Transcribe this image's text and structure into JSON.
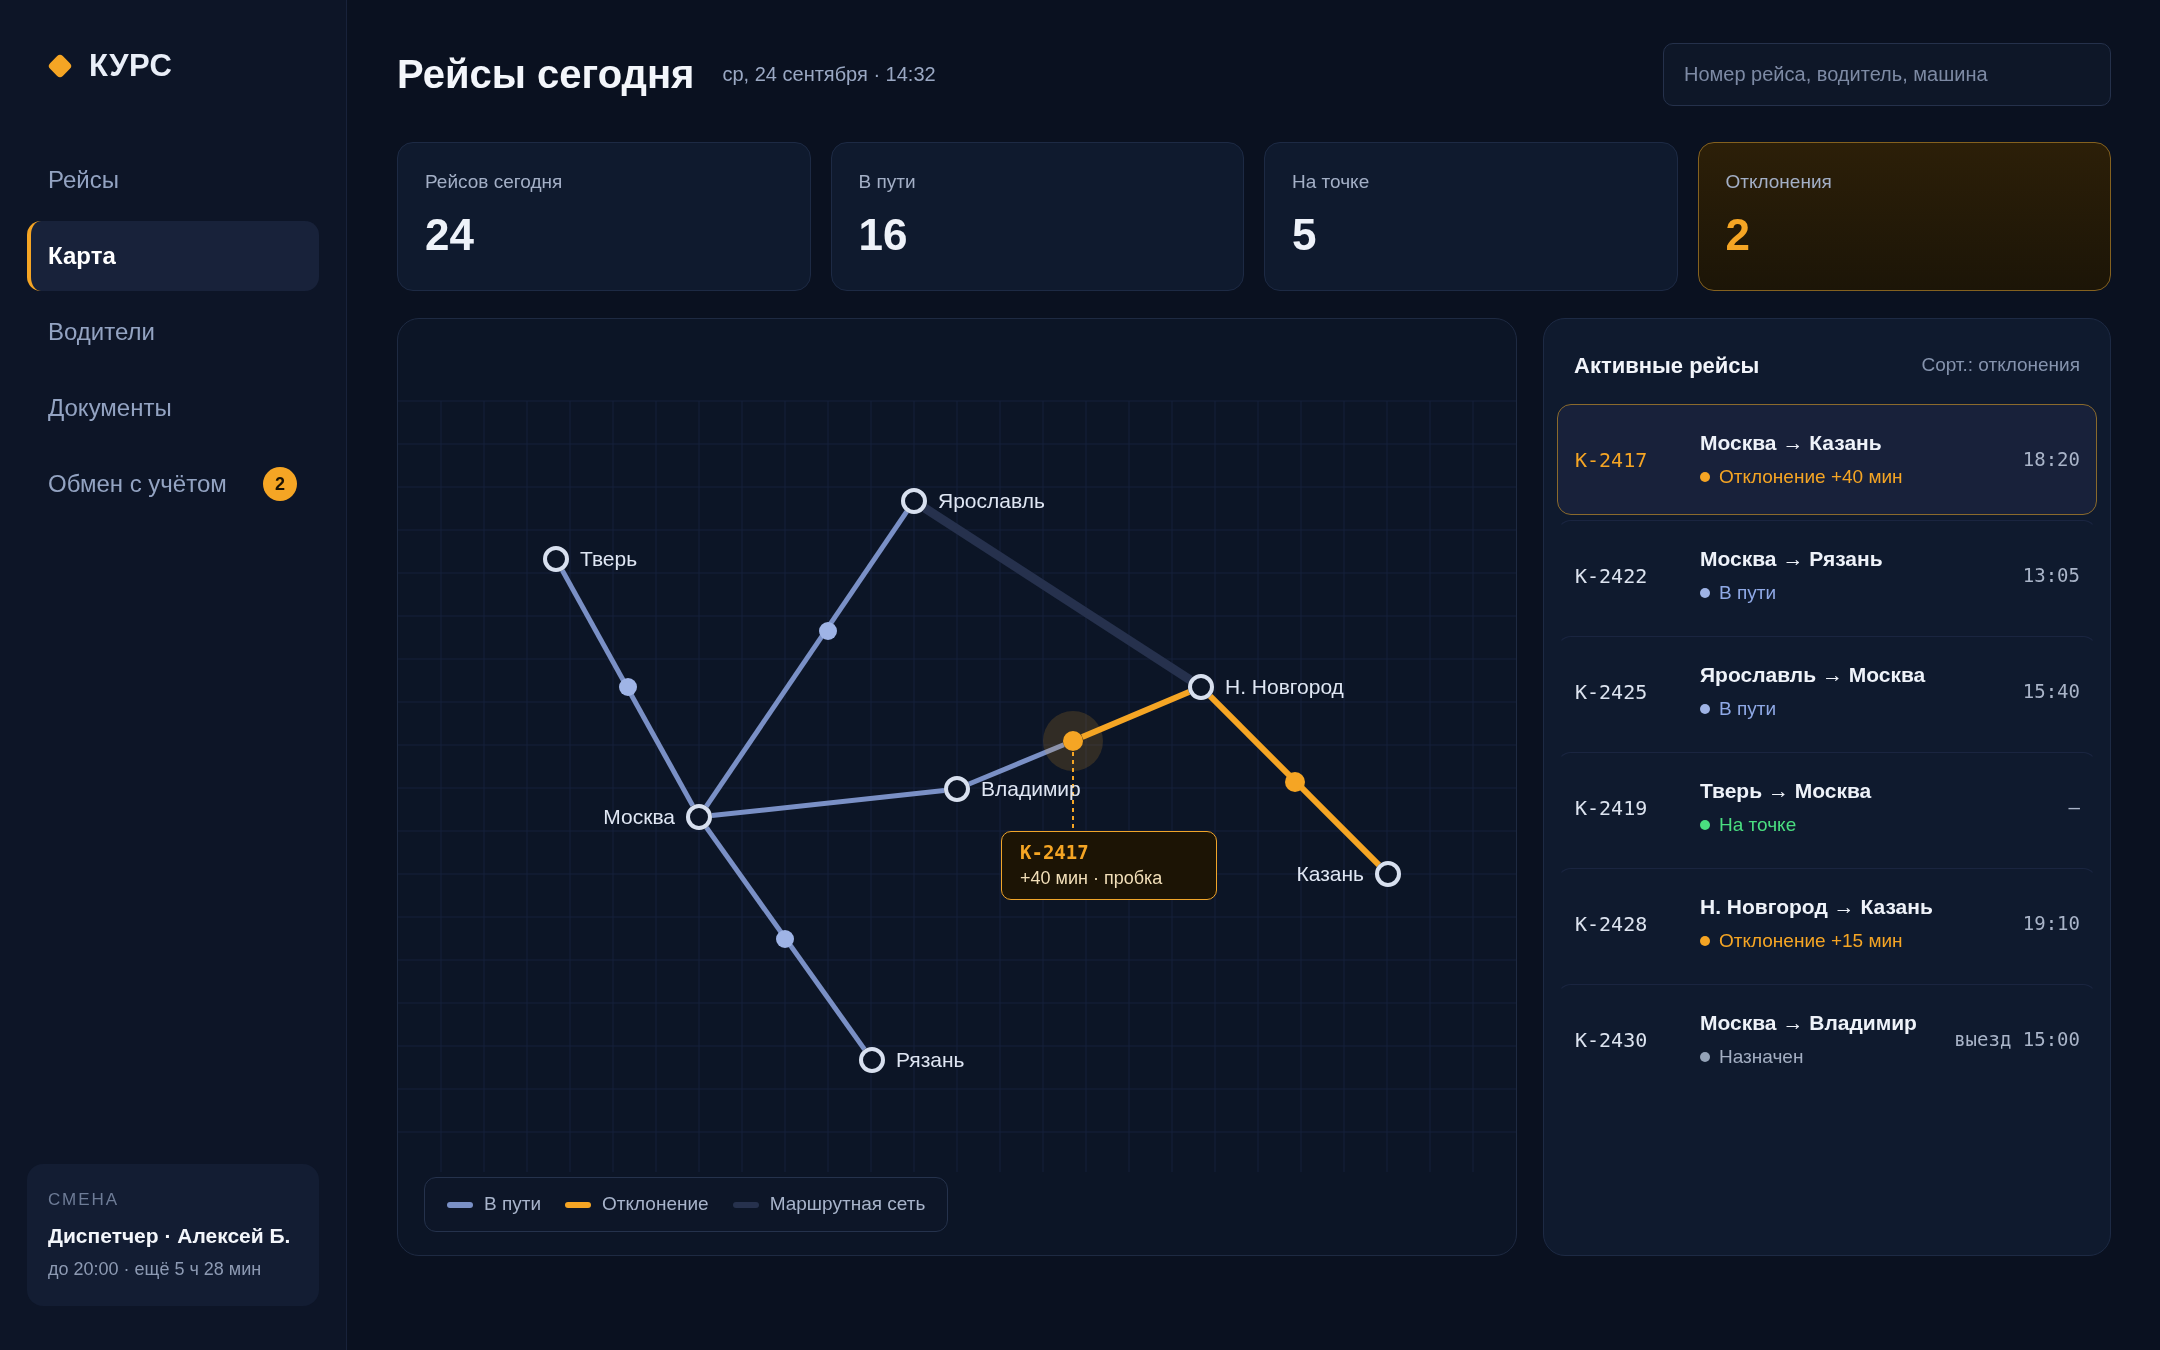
{
  "brand": {
    "name": "КУРС"
  },
  "sidebar": {
    "items": [
      {
        "label": "Рейсы",
        "selected": false
      },
      {
        "label": "Карта",
        "selected": true
      },
      {
        "label": "Водители",
        "selected": false
      },
      {
        "label": "Документы",
        "selected": false
      },
      {
        "label": "Обмен с учётом",
        "selected": false,
        "badge": "2"
      }
    ],
    "shift": {
      "label": "СМЕНА",
      "title": "Диспетчер · Алексей Б.",
      "subtitle": "до 20:00 · ещё 5 ч 28 мин"
    }
  },
  "header": {
    "title": "Рейсы сегодня",
    "date": "ср, 24 сентября · 14:32",
    "search": {
      "placeholder": "Номер рейса, водитель, машина"
    }
  },
  "stats": [
    {
      "label": "Рейсов сегодня",
      "value": "24",
      "kind": "normal"
    },
    {
      "label": "В пути",
      "value": "16",
      "kind": "normal"
    },
    {
      "label": "На точке",
      "value": "5",
      "kind": "normal"
    },
    {
      "label": "Отклонения",
      "value": "2",
      "kind": "alert"
    }
  ],
  "map": {
    "segments": [
      {
        "kind": "in_transit"
      },
      {
        "kind": "in_transit"
      },
      {
        "kind": "in_transit"
      },
      {
        "kind": "in_transit"
      },
      {
        "kind": "in_transit"
      },
      {
        "kind": "deviation"
      },
      {
        "kind": "deviation"
      },
      {
        "kind": "network"
      }
    ],
    "cities": [
      {
        "name": "Тверь"
      },
      {
        "name": "Ярославль"
      },
      {
        "name": "Москва"
      },
      {
        "name": "Владимир"
      },
      {
        "name": "Н. Новгород"
      },
      {
        "name": "Казань"
      },
      {
        "name": "Рязань"
      }
    ],
    "vehicles": [
      {
        "kind": "in_transit",
        "selected": false
      },
      {
        "kind": "in_transit",
        "selected": false
      },
      {
        "kind": "in_transit",
        "selected": false
      },
      {
        "kind": "deviation",
        "selected": true
      },
      {
        "kind": "deviation",
        "selected": false
      }
    ],
    "tooltip": {
      "trip": "К-2417",
      "note": "+40 мин · пробка"
    },
    "legend": [
      {
        "label": "В пути",
        "kind": "in_transit"
      },
      {
        "label": "Отклонение",
        "kind": "deviation"
      },
      {
        "label": "Маршрутная сеть",
        "kind": "network"
      }
    ]
  },
  "trips_panel": {
    "title": "Активные рейсы",
    "sort": "Сорт.: отклонения",
    "trips": [
      {
        "id": "К-2417",
        "route": "Москва → Казань",
        "status": "Отклонение +40 мин",
        "kind": "deviation",
        "time": "18:20",
        "selected": true
      },
      {
        "id": "К-2422",
        "route": "Москва → Рязань",
        "status": "В пути",
        "kind": "in_transit",
        "time": "13:05",
        "selected": false
      },
      {
        "id": "К-2425",
        "route": "Ярославль → Москва",
        "status": "В пути",
        "kind": "in_transit",
        "time": "15:40",
        "selected": false
      },
      {
        "id": "К-2419",
        "route": "Тверь → Москва",
        "status": "На точке",
        "kind": "at_point",
        "time": "–",
        "selected": false
      },
      {
        "id": "К-2428",
        "route": "Н. Новгород → Казань",
        "status": "Отклонение +15 мин",
        "kind": "deviation",
        "time": "19:10",
        "selected": false
      },
      {
        "id": "К-2430",
        "route": "Москва → Владимир",
        "status": "Назначен",
        "kind": "assigned",
        "time": "выезд 15:00",
        "selected": false
      }
    ]
  }
}
